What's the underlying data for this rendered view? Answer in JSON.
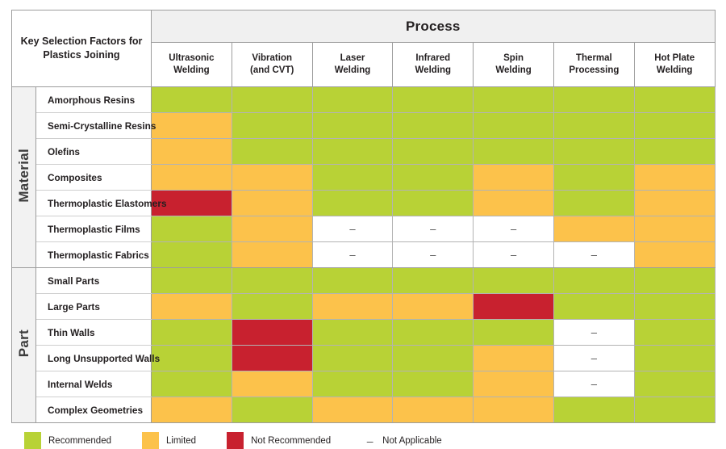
{
  "title_cell": {
    "line1": "Key Selection Factors for",
    "line2": "Plastics Joining"
  },
  "process_header": {
    "group_label": "Process",
    "columns": [
      {
        "line1": "Ultrasonic",
        "line2": "Welding"
      },
      {
        "line1": "Vibration",
        "line2": "(and CVT)"
      },
      {
        "line1": "Laser",
        "line2": "Welding"
      },
      {
        "line1": "Infrared",
        "line2": "Welding"
      },
      {
        "line1": "Spin",
        "line2": "Welding"
      },
      {
        "line1": "Thermal",
        "line2": "Processing"
      },
      {
        "line1": "Hot Plate",
        "line2": "Welding"
      }
    ]
  },
  "legend": {
    "items": [
      {
        "key": "rec",
        "swatch": "green-swatch",
        "label": "Recommended",
        "color": "#b8d236"
      },
      {
        "key": "lim",
        "swatch": "orange-swatch",
        "label": "Limited",
        "color": "#fcc24b"
      },
      {
        "key": "not",
        "swatch": "red-swatch",
        "label": "Not Recommended",
        "color": "#c8212f"
      },
      {
        "key": "na",
        "swatch": "dash-glyph",
        "label": "Not Applicable",
        "color": "#ffffff"
      }
    ],
    "na_glyph": "–"
  },
  "na_glyph": "–",
  "sections": [
    {
      "group": "Material",
      "rows": [
        {
          "label": "Amorphous Resins",
          "values": [
            "rec",
            "rec",
            "rec",
            "rec",
            "rec",
            "rec",
            "rec"
          ]
        },
        {
          "label": "Semi-Crystalline Resins",
          "values": [
            "lim",
            "rec",
            "rec",
            "rec",
            "rec",
            "rec",
            "rec"
          ]
        },
        {
          "label": "Olefins",
          "values": [
            "lim",
            "rec",
            "rec",
            "rec",
            "rec",
            "rec",
            "rec"
          ]
        },
        {
          "label": "Composites",
          "values": [
            "lim",
            "lim",
            "rec",
            "rec",
            "lim",
            "rec",
            "lim"
          ]
        },
        {
          "label": "Thermoplastic Elastomers",
          "values": [
            "not",
            "lim",
            "rec",
            "rec",
            "lim",
            "rec",
            "lim"
          ]
        },
        {
          "label": "Thermoplastic Films",
          "values": [
            "rec",
            "lim",
            "na",
            "na",
            "na",
            "lim",
            "lim"
          ]
        },
        {
          "label": "Thermoplastic Fabrics",
          "values": [
            "rec",
            "lim",
            "na",
            "na",
            "na",
            "na",
            "lim"
          ]
        }
      ]
    },
    {
      "group": "Part",
      "rows": [
        {
          "label": "Small Parts",
          "values": [
            "rec",
            "rec",
            "rec",
            "rec",
            "rec",
            "rec",
            "rec"
          ]
        },
        {
          "label": "Large Parts",
          "values": [
            "lim",
            "rec",
            "lim",
            "lim",
            "not",
            "rec",
            "rec"
          ]
        },
        {
          "label": "Thin Walls",
          "values": [
            "rec",
            "not",
            "rec",
            "rec",
            "rec",
            "na",
            "rec"
          ]
        },
        {
          "label": "Long Unsupported Walls",
          "values": [
            "rec",
            "not",
            "rec",
            "rec",
            "lim",
            "na",
            "rec"
          ]
        },
        {
          "label": "Internal Welds",
          "values": [
            "rec",
            "lim",
            "rec",
            "rec",
            "lim",
            "na",
            "rec"
          ]
        },
        {
          "label": "Complex Geometries",
          "values": [
            "lim",
            "rec",
            "lim",
            "lim",
            "lim",
            "rec",
            "rec"
          ]
        }
      ]
    }
  ]
}
